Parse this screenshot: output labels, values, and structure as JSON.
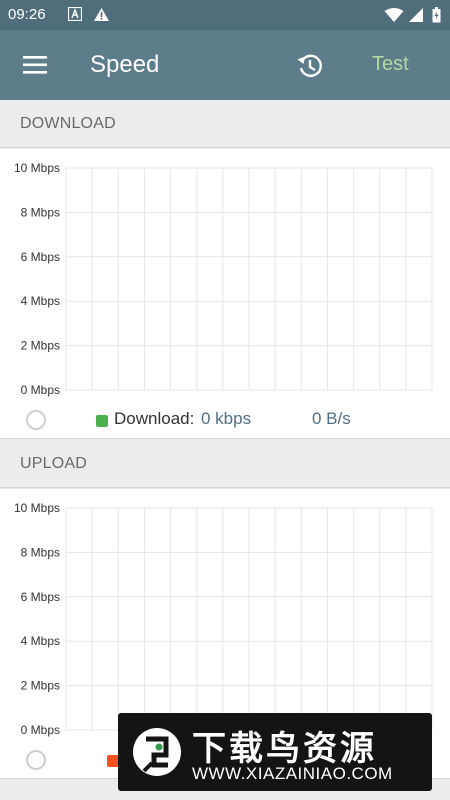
{
  "status_bar": {
    "time": "09:26",
    "icons": [
      "font-icon",
      "warning-icon",
      "wifi-icon",
      "signal-icon",
      "battery-icon"
    ]
  },
  "app_bar": {
    "menu_icon": "hamburger-menu-icon",
    "title": "Speed",
    "history_icon": "history-icon",
    "test_label": "Test"
  },
  "download": {
    "section_title": "DOWNLOAD",
    "legend_label": "Download:",
    "rate_kbps": "0 kbps",
    "rate_bytes": "0 B/s",
    "color": "#4caf50"
  },
  "upload": {
    "section_title": "UPLOAD",
    "color": "#f4511e"
  },
  "chart_data": [
    {
      "type": "line",
      "y_ticks": [
        "10 Mbps",
        "8 Mbps",
        "6 Mbps",
        "4 Mbps",
        "2 Mbps",
        "0 Mbps"
      ],
      "ylim": [
        0,
        10
      ],
      "grid": true,
      "series": []
    },
    {
      "type": "line",
      "y_ticks": [
        "10 Mbps",
        "8 Mbps",
        "6 Mbps",
        "4 Mbps",
        "2 Mbps",
        "0 Mbps"
      ],
      "ylim": [
        0,
        10
      ],
      "grid": true,
      "series": []
    }
  ],
  "watermark": {
    "chinese_text": "下载鸟资源",
    "url": "WWW.XIAZAINIAO.COM"
  },
  "colors": {
    "status_bar": "#4f6d7b",
    "app_bar": "#5e7d8b",
    "test_accent": "#b6d7a1",
    "rate_text": "#4e6f86"
  }
}
